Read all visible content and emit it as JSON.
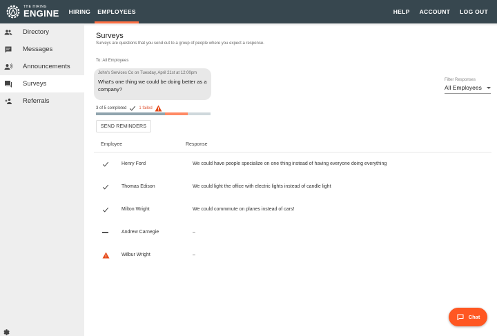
{
  "header": {
    "logo_small": "THE HIRING",
    "logo_big": "ENGINE",
    "nav": [
      {
        "label": "HIRING"
      },
      {
        "label": "EMPLOYEES"
      }
    ],
    "right_nav": [
      {
        "label": "HELP"
      },
      {
        "label": "ACCOUNT"
      },
      {
        "label": "LOG OUT"
      }
    ],
    "active_tab_color": "#ff7043"
  },
  "sidebar": {
    "items": [
      {
        "label": "Directory",
        "icon": "people-icon"
      },
      {
        "label": "Messages",
        "icon": "message-icon"
      },
      {
        "label": "Announcements",
        "icon": "announcement-icon"
      },
      {
        "label": "Surveys",
        "icon": "survey-icon",
        "active": true
      },
      {
        "label": "Referrals",
        "icon": "add-person-icon"
      }
    ],
    "settings_icon": "gear-icon"
  },
  "main": {
    "title": "Surveys",
    "subtitle": "Surveys are questions that you send out to a group of people where you expect a response.",
    "to_line": "To: All Employees",
    "bubble": {
      "meta": "John's Services Co on Tuesday, April 21st at 12:00pm",
      "text": "What's one thing we could be doing better as a company?"
    },
    "filter": {
      "label": "Filter Responses",
      "value": "All Employees"
    },
    "status": {
      "completed": "3 of 5 completed",
      "failed": "1 failed"
    },
    "progress": {
      "completed_fraction": 0.6,
      "failed_fraction": 0.2
    },
    "send_reminders_label": "SEND REMINDERS",
    "table": {
      "headers": {
        "employee": "Employee",
        "response": "Response"
      },
      "rows": [
        {
          "status": "check",
          "name": "Henry Ford",
          "response": "We could have people specialize on one thing instead of having everyone doing everything"
        },
        {
          "status": "check",
          "name": "Thomas Edison",
          "response": "We could light the office with electric lights instead of candle light"
        },
        {
          "status": "check",
          "name": "Milton Wright",
          "response": "We could commmute on planes instead of cars!"
        },
        {
          "status": "pending",
          "name": "Andrew Carnegie",
          "response": "–"
        },
        {
          "status": "failed",
          "name": "Wilbur Wright",
          "response": "–"
        }
      ]
    },
    "chat_label": "Chat",
    "accent": "#ff5722",
    "warn_color": "#e64a19"
  }
}
